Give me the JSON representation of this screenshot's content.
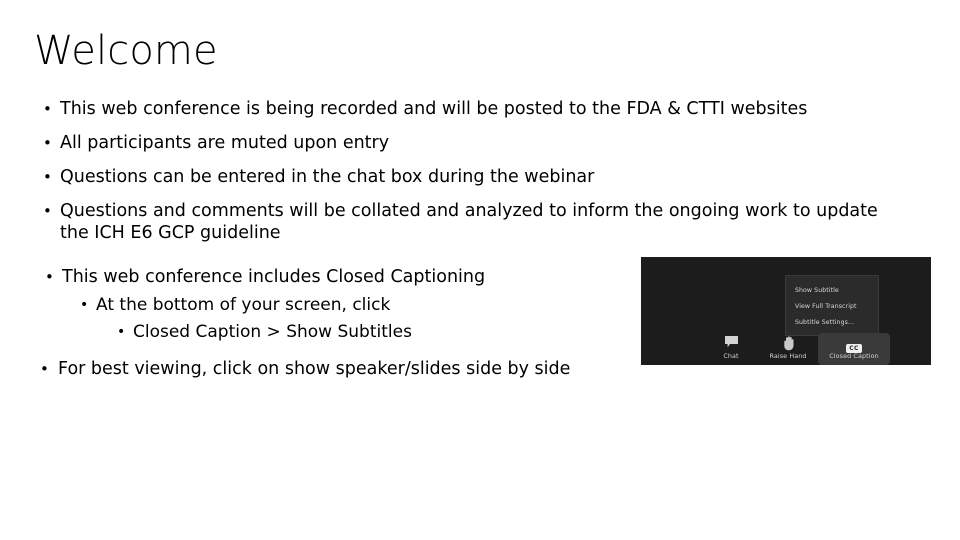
{
  "slide": {
    "title": "Welcome",
    "background_color": "#ffffff",
    "text_color": "#000000"
  },
  "bullets": {
    "b1": "This web conference is being recorded and will be posted to the FDA & CTTI websites",
    "b2": "All participants are muted upon entry",
    "b3": "Questions can be entered in the chat box during the webinar",
    "b4": "Questions and comments will be collated and analyzed to inform the ongoing work to update the ICH E6 GCP guideline",
    "b5": "This web conference includes Closed Captioning",
    "b5_sub1": "At the bottom of your screen, click",
    "b5_sub2": "Closed Caption > Show Subtitles",
    "b6": "For best viewing, click on show speaker/slides side by side",
    "marker_glyph": "•"
  },
  "screenshot": {
    "alt_name": "zoom-closed-caption-screenshot",
    "background_color": "#1c1c1c",
    "menu": {
      "background_color": "#2b2b2b",
      "items": [
        "Show Subtitle",
        "View Full Transcript",
        "Subtitle Settings..."
      ]
    },
    "toolbar": {
      "chat_label": "Chat",
      "raise_hand_label": "Raise Hand",
      "closed_caption_label": "Closed Caption",
      "cc_badge_text": "CC",
      "active_button_color": "#3a3a3a"
    }
  }
}
